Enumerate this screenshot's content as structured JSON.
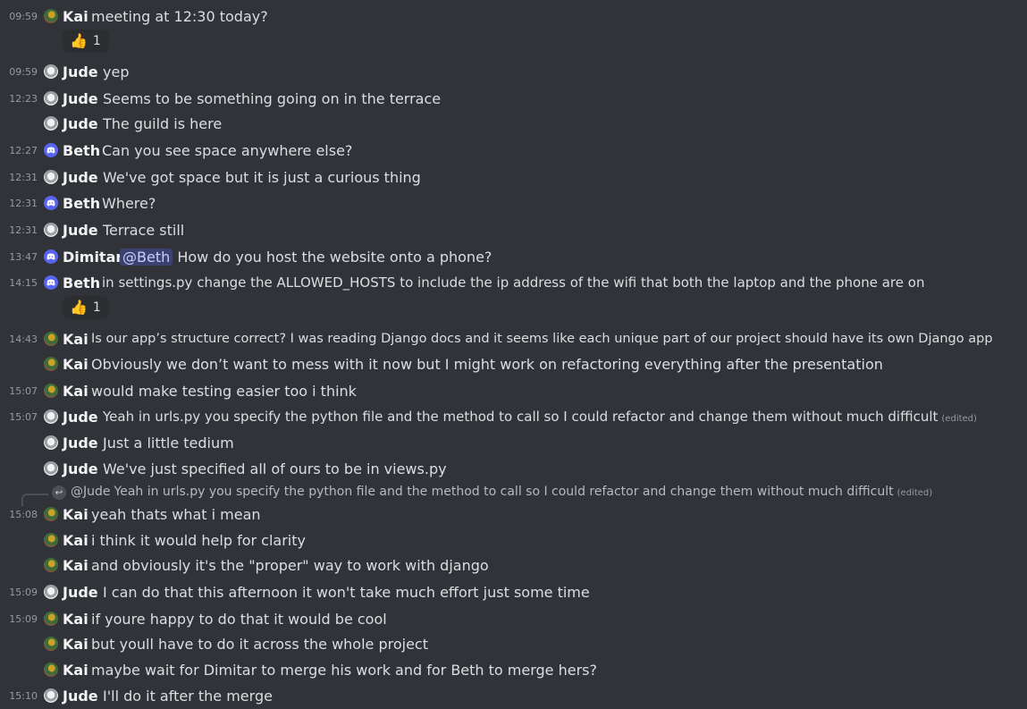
{
  "reply": {
    "name": "@Jude",
    "text": "Yeah in urls.py you specify the python file and the method to call so I could refactor and change them without much difficult",
    "edited": "(edited)"
  },
  "reactions": [
    {
      "emoji": "👍",
      "count": "1"
    },
    {
      "emoji": "👍",
      "count": "1"
    }
  ],
  "messages": [
    {
      "time": "09:59",
      "author": "Kai",
      "text": "meeting at 12:30 today?"
    },
    {
      "time": "09:59",
      "author": "Jude",
      "text": "yep"
    },
    {
      "time": "12:23",
      "author": "Jude",
      "text": "Seems to be something going on in the terrace"
    },
    {
      "time": "",
      "author": "Jude",
      "text": "The guild is here"
    },
    {
      "time": "12:27",
      "author": "Beth",
      "text": "Can you see space anywhere else?"
    },
    {
      "time": "12:31",
      "author": "Jude",
      "text": "We've got space but it is just a curious thing"
    },
    {
      "time": "12:31",
      "author": "Beth",
      "text": "Where?"
    },
    {
      "time": "12:31",
      "author": "Jude",
      "text": "Terrace still"
    },
    {
      "time": "13:47",
      "author": "Dimitar",
      "mention": "@Beth",
      "text": "How do you host the website onto a phone?"
    },
    {
      "time": "14:15",
      "author": "Beth",
      "text": "in settings.py change the ALLOWED_HOSTS to include the ip address of the wifi that both the laptop and the phone are on"
    },
    {
      "time": "14:43",
      "author": "Kai",
      "text": "Is our app’s structure correct? I was reading Django docs and it seems like each unique part of our project should have its own Django app"
    },
    {
      "time": "",
      "author": "Kai",
      "text": "Obviously we don’t want to mess with it now but I might work on refactoring everything after the presentation"
    },
    {
      "time": "15:07",
      "author": "Kai",
      "text": "would make testing easier too i think"
    },
    {
      "time": "15:07",
      "author": "Jude",
      "text": "Yeah in urls.py you specify the python file and the method to call so I could refactor and change them without much difficult",
      "edited": "(edited)"
    },
    {
      "time": "",
      "author": "Jude",
      "text": "Just a little tedium"
    },
    {
      "time": "",
      "author": "Jude",
      "text": "We've just specified all of ours to be in views.py"
    },
    {
      "time": "15:08",
      "author": "Kai",
      "text": "yeah thats what i mean"
    },
    {
      "time": "",
      "author": "Kai",
      "text": "i think it would help for clarity"
    },
    {
      "time": "",
      "author": "Kai",
      "text": "and obviously it's the \"proper\" way to work with django"
    },
    {
      "time": "15:09",
      "author": "Jude",
      "text": "I can do that this afternoon it won't take much effort just some time"
    },
    {
      "time": "15:09",
      "author": "Kai",
      "text": "if youre happy to do that it would be cool"
    },
    {
      "time": "",
      "author": "Kai",
      "text": "but youll have to do it across the whole project"
    },
    {
      "time": "",
      "author": "Kai",
      "text": "maybe wait for Dimitar to merge his work and for Beth to merge hers?"
    },
    {
      "time": "15:10",
      "author": "Jude",
      "text": "I'll do it after the merge"
    }
  ]
}
